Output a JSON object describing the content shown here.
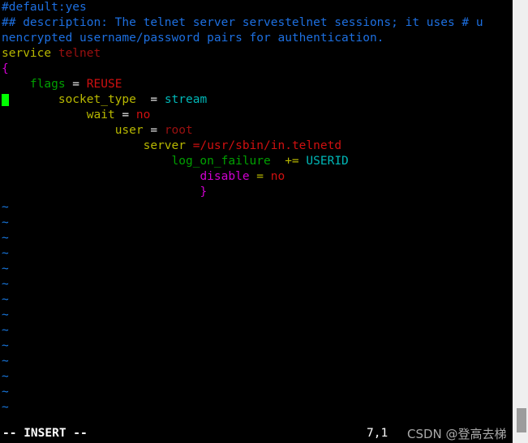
{
  "app": {
    "name": "vim",
    "mode": "-- INSERT --",
    "cursor_position": "7,1",
    "watermark": "CSDN @登高去梯"
  },
  "colors": {
    "background": "#000000",
    "comment": "#1d6fe0",
    "keyword": "#b8b800",
    "string": "#b00000",
    "brace": "#d000d0",
    "identifier": "#00a000",
    "constant": "#00b8b8",
    "tilde": "#1878e0",
    "cursor": "#00ff00",
    "status_text": "#ffffff",
    "scrollbar_track": "#efefef",
    "scrollbar_thumb": "#9c9c9c"
  },
  "editor": {
    "filetype": "xinetd-conf",
    "lines": [
      {
        "number": 1,
        "tokens": [
          {
            "text": "#default:yes",
            "class": "c-comment"
          }
        ]
      },
      {
        "number": 2,
        "tokens": [
          {
            "text": "## description: The telnet server servestelnet sessions; it uses # u",
            "class": "c-comment"
          }
        ]
      },
      {
        "number": 3,
        "tokens": [
          {
            "text": "nencrypted username/password pairs for authentication.",
            "class": "c-comment"
          }
        ]
      },
      {
        "number": 4,
        "tokens": [
          {
            "text": "service ",
            "class": "c-keyword"
          },
          {
            "text": "telnet",
            "class": "c-darkred"
          }
        ]
      },
      {
        "number": 5,
        "tokens": [
          {
            "text": "{",
            "class": "c-brace"
          }
        ]
      },
      {
        "number": 6,
        "tokens": [
          {
            "text": "    ",
            "class": "c-op"
          },
          {
            "text": "flags",
            "class": "c-ident"
          },
          {
            "text": " = ",
            "class": "c-op"
          },
          {
            "text": "REUSE",
            "class": "c-red"
          }
        ]
      },
      {
        "number": 7,
        "cursor": true,
        "tokens": [
          {
            "text": "        ",
            "class": "c-op"
          },
          {
            "text": "socket_type",
            "class": "c-keyword"
          },
          {
            "text": "  ",
            "class": "c-op"
          },
          {
            "text": "=",
            "class": "c-op"
          },
          {
            "text": " ",
            "class": "c-op"
          },
          {
            "text": "stream",
            "class": "c-cyan"
          }
        ]
      },
      {
        "number": 8,
        "tokens": [
          {
            "text": "            ",
            "class": "c-op"
          },
          {
            "text": "wait",
            "class": "c-keyword"
          },
          {
            "text": " = ",
            "class": "c-op"
          },
          {
            "text": "no",
            "class": "c-red"
          }
        ]
      },
      {
        "number": 9,
        "tokens": [
          {
            "text": "                ",
            "class": "c-op"
          },
          {
            "text": "user",
            "class": "c-keyword"
          },
          {
            "text": " = ",
            "class": "c-op"
          },
          {
            "text": "root",
            "class": "c-darkred"
          }
        ]
      },
      {
        "number": 10,
        "tokens": [
          {
            "text": "                    ",
            "class": "c-op"
          },
          {
            "text": "server",
            "class": "c-keyword"
          },
          {
            "text": " ",
            "class": "c-op"
          },
          {
            "text": "=/usr/sbin/in.telnetd",
            "class": "c-red"
          }
        ]
      },
      {
        "number": 11,
        "tokens": [
          {
            "text": "                        ",
            "class": "c-op"
          },
          {
            "text": "log_on_failure",
            "class": "c-ident"
          },
          {
            "text": "  ",
            "class": "c-op"
          },
          {
            "text": "+=",
            "class": "c-opy"
          },
          {
            "text": " ",
            "class": "c-op"
          },
          {
            "text": "USERID",
            "class": "c-cyan"
          }
        ]
      },
      {
        "number": 12,
        "tokens": [
          {
            "text": "                            ",
            "class": "c-op"
          },
          {
            "text": "disable",
            "class": "c-magenta"
          },
          {
            "text": " ",
            "class": "c-op"
          },
          {
            "text": "=",
            "class": "c-opy"
          },
          {
            "text": " ",
            "class": "c-op"
          },
          {
            "text": "no",
            "class": "c-red"
          }
        ]
      },
      {
        "number": 13,
        "tokens": [
          {
            "text": "                            ",
            "class": "c-op"
          },
          {
            "text": "}",
            "class": "c-brace"
          }
        ]
      }
    ],
    "empty_marker": "~",
    "empty_line_count": 14
  }
}
